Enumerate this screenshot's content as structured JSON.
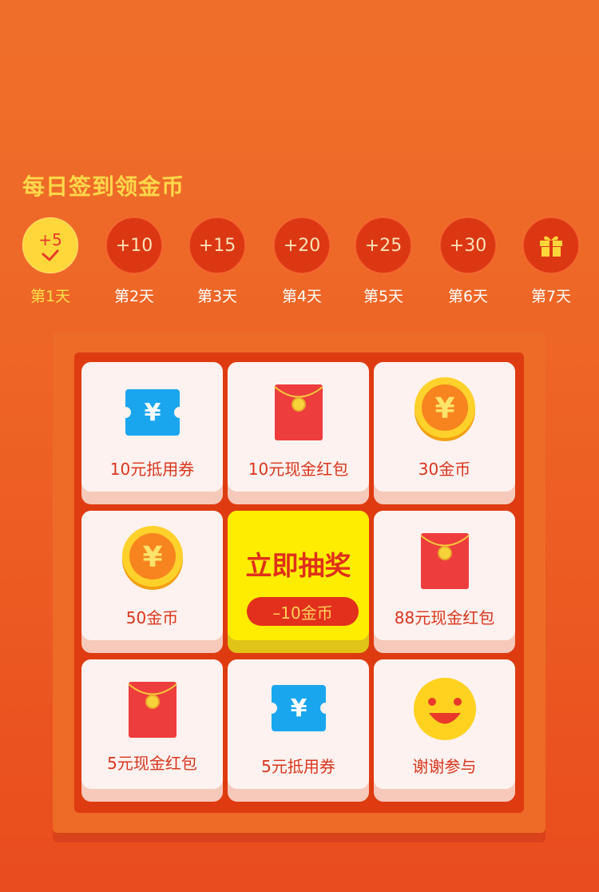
{
  "title": "每日签到领金币",
  "days": [
    {
      "amount": "+5",
      "label": "第1天",
      "checked": true
    },
    {
      "amount": "+10",
      "label": "第2天"
    },
    {
      "amount": "+15",
      "label": "第3天"
    },
    {
      "amount": "+20",
      "label": "第4天"
    },
    {
      "amount": "+25",
      "label": "第5天"
    },
    {
      "amount": "+30",
      "label": "第6天"
    },
    {
      "amount": "",
      "label": "第7天",
      "icon": "gift-icon"
    }
  ],
  "prizes": [
    {
      "label": "10元抵用券",
      "icon": "coupon-icon"
    },
    {
      "label": "10元现金红包",
      "icon": "red-envelope-icon"
    },
    {
      "label": "30金币",
      "icon": "gold-coin-icon"
    },
    {
      "label": "50金币",
      "icon": "gold-coin-icon"
    },
    {
      "label": "88元现金红包",
      "icon": "red-envelope-icon"
    },
    {
      "label": "5元现金红包",
      "icon": "red-envelope-icon"
    },
    {
      "label": "5元抵用券",
      "icon": "coupon-icon"
    },
    {
      "label": "谢谢参与",
      "icon": "smiley-icon"
    }
  ],
  "draw": {
    "title": "立即抽奖",
    "cost": "–10金币"
  },
  "colors": {
    "accent": "#ffd73a",
    "board": "#df3b10",
    "text_red": "#d9351d",
    "draw_yellow": "#ffed00"
  }
}
